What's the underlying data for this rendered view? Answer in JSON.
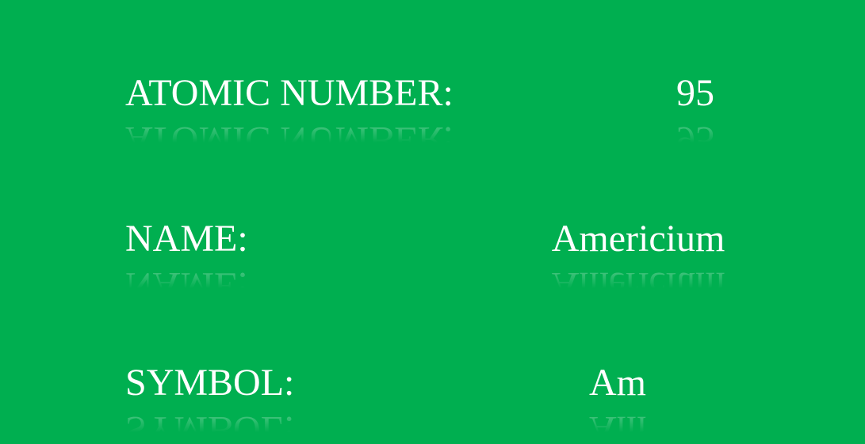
{
  "slide": {
    "background_color": "#00AF50",
    "text_color": "#FFFFFF",
    "rows": [
      {
        "label": "ATOMIC NUMBER:",
        "value": "95"
      },
      {
        "label": "NAME:",
        "value": "Americium"
      },
      {
        "label": "SYMBOL:",
        "value": "Am"
      }
    ]
  }
}
